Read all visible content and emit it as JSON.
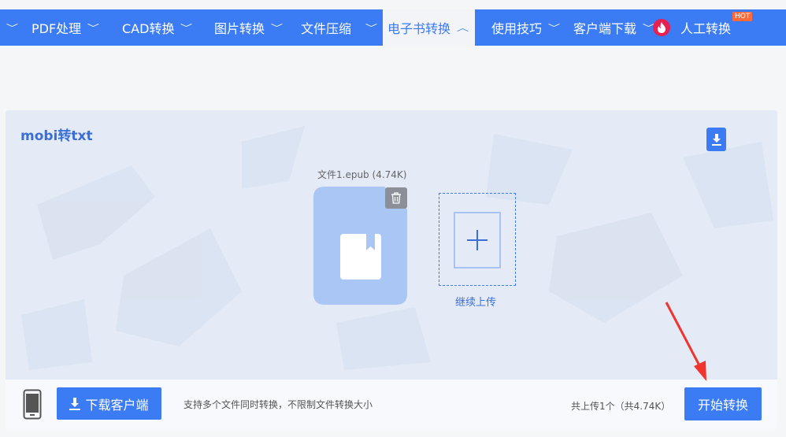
{
  "nav": {
    "items": [
      {
        "label": "PDF处理",
        "chevron": "﹀"
      },
      {
        "label": "CAD转换",
        "chevron": "﹀"
      },
      {
        "label": "图片转换",
        "chevron": "﹀"
      },
      {
        "label": "文件压缩",
        "chevron": "﹀"
      },
      {
        "label": "电子书转换",
        "chevron": "︿"
      },
      {
        "label": "使用技巧",
        "chevron": "﹀"
      },
      {
        "label": "客户端下载",
        "chevron": "﹀"
      },
      {
        "label": "人工转换"
      }
    ],
    "hot_badge": "HOT",
    "active_index": 4,
    "colors": {
      "bar": "#3b7bf4",
      "active_bg": "#f2f4f7",
      "hot": "#ff6a3d",
      "fire": "#e8204f"
    }
  },
  "panel": {
    "title": "mobi转txt",
    "file": {
      "name": "文件1.epub",
      "size": "(4.74K)"
    },
    "upload_more_label": "继续上传",
    "icons": {
      "download": "download-icon",
      "trash": "trash-icon",
      "plus": "plus-icon",
      "book": "book-icon",
      "phone": "phone-icon"
    }
  },
  "bottom": {
    "download_client_label": "下载客户端",
    "tip": "支持多个文件同时转换，不限制文件转换大小",
    "count": "共上传1个（共4.74K）",
    "start_label": "开始转换"
  }
}
